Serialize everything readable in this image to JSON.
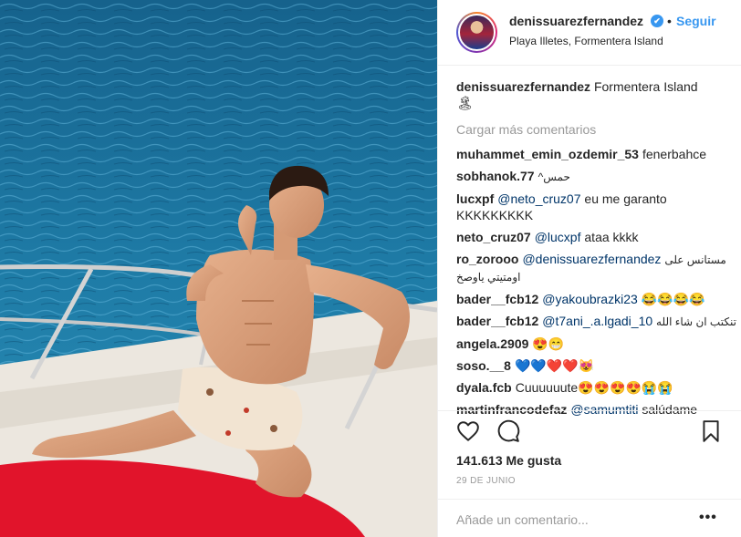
{
  "header": {
    "username": "denissuarezfernandez",
    "verified_glyph": "✔",
    "separator": "•",
    "follow_label": "Seguir",
    "location": "Playa Illetes, Formentera Island"
  },
  "caption": {
    "username": "denissuarezfernandez",
    "text": "Formentera Island",
    "emoji": "🏝"
  },
  "load_more_label": "Cargar más comentarios",
  "comments": [
    {
      "user": "muhammet_emin_ozdemir_53",
      "text": "fenerbahce"
    },
    {
      "user": "sobhanok.77",
      "text": "^حمس"
    },
    {
      "user": "lucxpf",
      "mention": "@neto_cruz07",
      "text": "eu me garanto KKKKKKKKK"
    },
    {
      "user": "neto_cruz07",
      "mention": "@lucxpf",
      "text": "ataa kkkk"
    },
    {
      "user": "ro_zorooo",
      "mention": "@denissuarezfernandez",
      "text": "مستانس على اومتيتي ياوصخ"
    },
    {
      "user": "bader__fcb12",
      "mention": "@yakoubrazki23",
      "text": "😂😂😂😂"
    },
    {
      "user": "bader__fcb12",
      "mention": "@t7ani_.a.lgadi_10",
      "text": "تنكتب ان شاء الله"
    },
    {
      "user": "angela.2909",
      "text": "😍😁"
    },
    {
      "user": "soso.__8",
      "text": "💙💙❤️❤️😻"
    },
    {
      "user": "dyala.fcb",
      "text": "Cuuuuuute😍😍😍😍😭😭"
    },
    {
      "user": "martinfrancodefaz",
      "mention": "@samumtiti",
      "text": "salúdame"
    }
  ],
  "actions": {
    "like_icon": "heart-outline-icon",
    "comment_icon": "speech-bubble-icon",
    "save_icon": "bookmark-icon"
  },
  "likes_label": "141.613 Me gusta",
  "date_label": "29 DE JUNIO",
  "add_comment_placeholder": "Añade un comentario...",
  "more_glyph": "•••"
}
